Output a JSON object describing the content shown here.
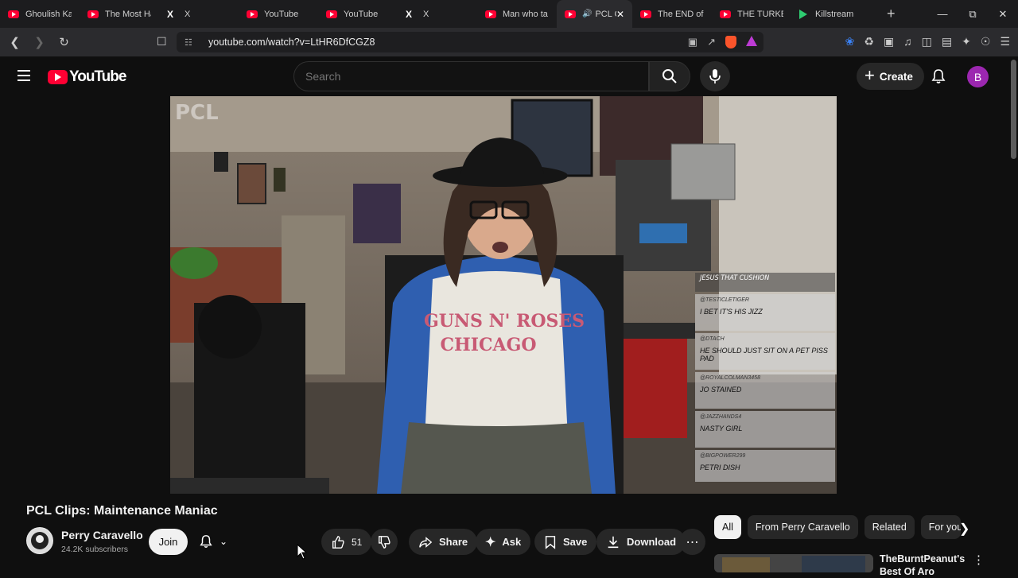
{
  "browser": {
    "tabs": [
      {
        "label": "Ghoulish Kar",
        "icon": "youtube-icon"
      },
      {
        "label": "The Most Ha",
        "icon": "youtube-icon"
      },
      {
        "label": "X",
        "icon": "x-icon"
      },
      {
        "label": "YouTube",
        "icon": "youtube-icon"
      },
      {
        "label": "YouTube",
        "icon": "youtube-icon"
      },
      {
        "label": "X",
        "icon": "x-icon"
      },
      {
        "label": "Man who ta",
        "icon": "youtube-icon"
      },
      {
        "label": "PCL C",
        "icon": "youtube-icon",
        "active": true
      },
      {
        "label": "The END of",
        "icon": "youtube-icon"
      },
      {
        "label": "THE TURKEY",
        "icon": "youtube-icon"
      },
      {
        "label": "Killstream",
        "icon": "kick-icon"
      }
    ],
    "new_tab": "+",
    "url": "youtube.com/watch?v=LtHR6DfCGZ8"
  },
  "header": {
    "logo_text": "YouTube",
    "search_placeholder": "Search",
    "create_label": "Create",
    "avatar_letter": "B"
  },
  "video": {
    "title": "PCL Clips: Maintenance Maniac",
    "channel_name": "Perry Caravello",
    "subscribers": "24.2K subscribers",
    "join_label": "Join",
    "likes": "51",
    "share_label": "Share",
    "ask_label": "Ask",
    "save_label": "Save",
    "download_label": "Download"
  },
  "overlay": {
    "watermark": "PCL",
    "chat": [
      {
        "user": "",
        "message": "JESUS THAT CUSHION"
      },
      {
        "user": "@TESTICLETIGER",
        "message": "I BET IT'S HIS JIZZ"
      },
      {
        "user": "@DTACH",
        "message": "HE SHOULD JUST SIT ON A PET PISS PAD"
      },
      {
        "user": "@ROYALCOLMAN3458",
        "message": "JO STAINED"
      },
      {
        "user": "@JAZZHANDS4",
        "message": "NASTY GIRL"
      },
      {
        "user": "@BIGPOWER299",
        "message": "PETRI DISH"
      }
    ]
  },
  "sidebar": {
    "chips": [
      {
        "label": "All",
        "active": true
      },
      {
        "label": "From Perry Caravello"
      },
      {
        "label": "Related"
      },
      {
        "label": "For you"
      }
    ],
    "recommendation": {
      "channel": "TheBurntPeanut's",
      "title": "Best Of Aro"
    }
  },
  "colors": {
    "youtube_red": "#ff0033",
    "avatar_purple": "#9c27b0",
    "background": "#0f0f0f"
  }
}
